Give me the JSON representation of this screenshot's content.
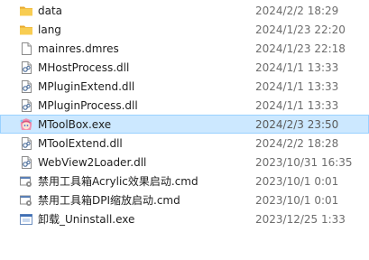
{
  "files": [
    {
      "name": "data",
      "modified": "2024/2/2 18:29",
      "icon": "folder-icon",
      "selected": false
    },
    {
      "name": "lang",
      "modified": "2024/1/23 22:20",
      "icon": "folder-icon",
      "selected": false
    },
    {
      "name": "mainres.dmres",
      "modified": "2024/1/23 22:18",
      "icon": "generic-file-icon",
      "selected": false
    },
    {
      "name": "MHostProcess.dll",
      "modified": "2024/1/1 13:33",
      "icon": "dll-file-icon",
      "selected": false
    },
    {
      "name": "MPluginExtend.dll",
      "modified": "2024/1/1 13:33",
      "icon": "dll-file-icon",
      "selected": false
    },
    {
      "name": "MPluginProcess.dll",
      "modified": "2024/1/1 13:33",
      "icon": "dll-file-icon",
      "selected": false
    },
    {
      "name": "MToolBox.exe",
      "modified": "2024/2/3 23:50",
      "icon": "app-mascot-icon",
      "selected": true
    },
    {
      "name": "MToolExtend.dll",
      "modified": "2024/2/2 18:28",
      "icon": "dll-file-icon",
      "selected": false
    },
    {
      "name": "WebView2Loader.dll",
      "modified": "2023/10/31 16:35",
      "icon": "dll-file-icon",
      "selected": false
    },
    {
      "name": "禁用工具箱Acrylic效果启动.cmd",
      "modified": "2023/10/1 0:01",
      "icon": "cmd-script-icon",
      "selected": false
    },
    {
      "name": "禁用工具箱DPI缩放启动.cmd",
      "modified": "2023/10/1 0:01",
      "icon": "cmd-script-icon",
      "selected": false
    },
    {
      "name": "卸载_Uninstall.exe",
      "modified": "2023/12/25 1:33",
      "icon": "installer-exe-icon",
      "selected": false
    }
  ],
  "colors": {
    "selection_bg": "#cce8ff",
    "selection_border": "#99d1ff",
    "folder": "#f5c343",
    "date_text": "#6d6d6d"
  }
}
